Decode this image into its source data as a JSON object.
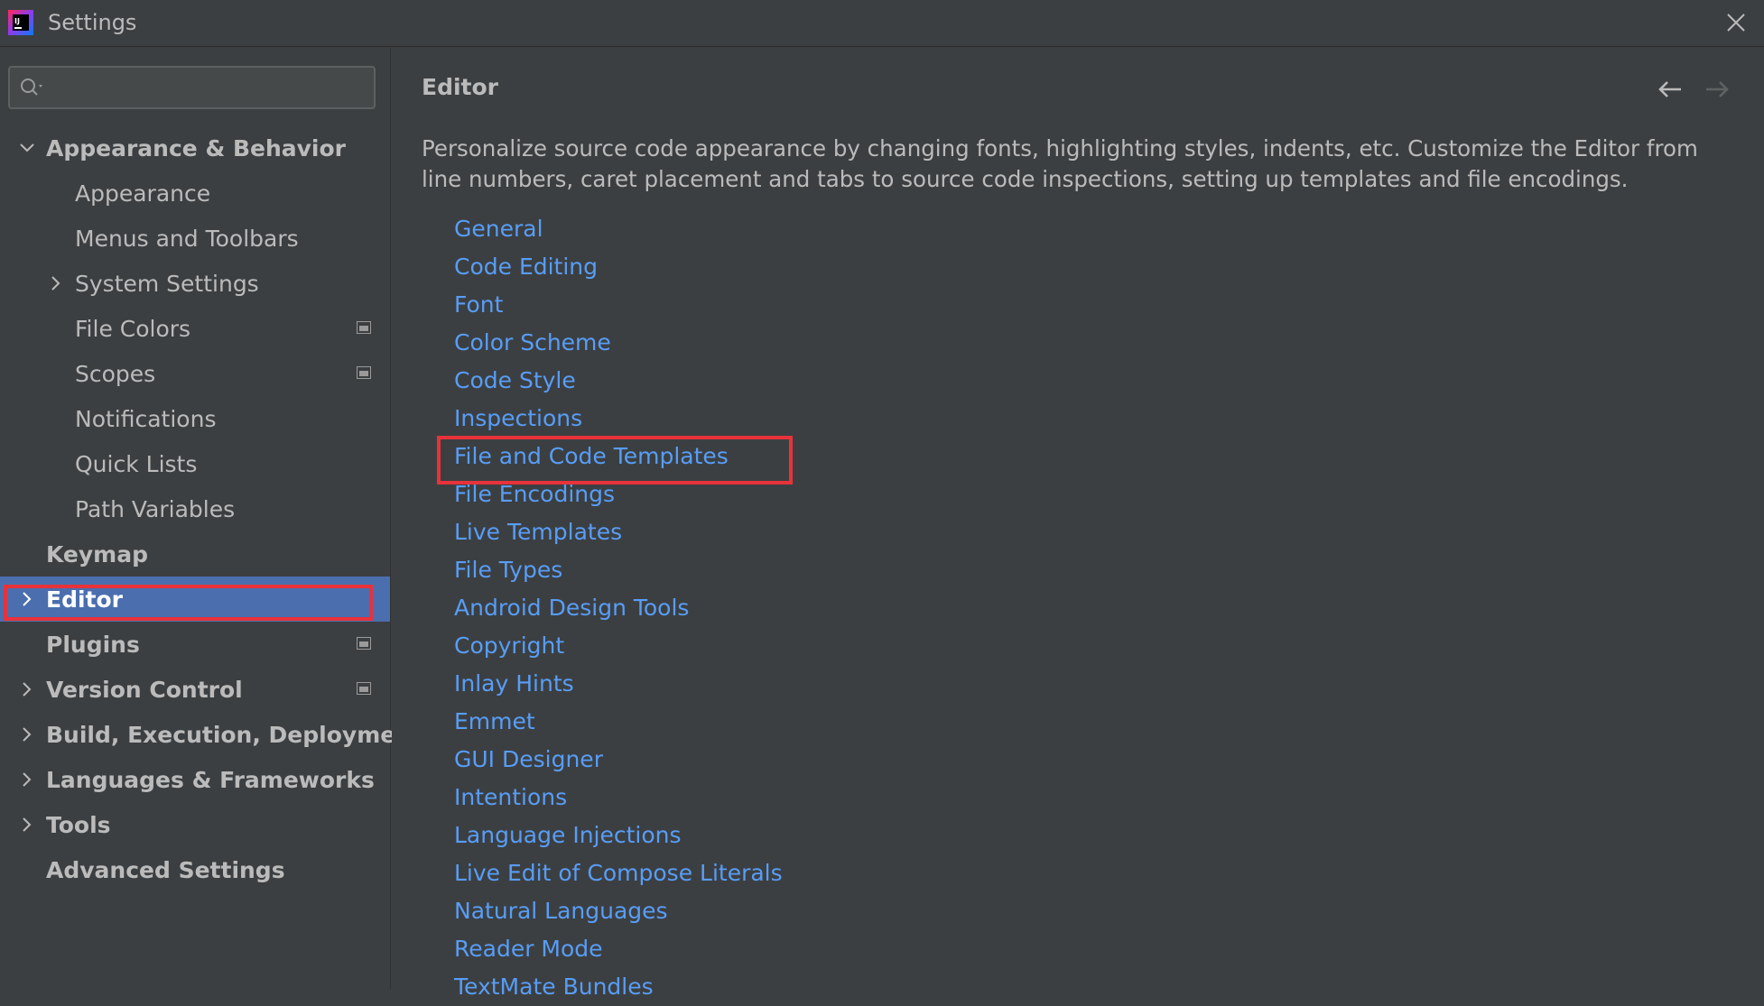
{
  "window": {
    "title": "Settings"
  },
  "search": {
    "placeholder": ""
  },
  "sidebar": {
    "items": [
      {
        "label": "Appearance & Behavior"
      },
      {
        "label": "Appearance"
      },
      {
        "label": "Menus and Toolbars"
      },
      {
        "label": "System Settings"
      },
      {
        "label": "File Colors"
      },
      {
        "label": "Scopes"
      },
      {
        "label": "Notifications"
      },
      {
        "label": "Quick Lists"
      },
      {
        "label": "Path Variables"
      },
      {
        "label": "Keymap"
      },
      {
        "label": "Editor"
      },
      {
        "label": "Plugins"
      },
      {
        "label": "Version Control"
      },
      {
        "label": "Build, Execution, Deployment"
      },
      {
        "label": "Languages & Frameworks"
      },
      {
        "label": "Tools"
      },
      {
        "label": "Advanced Settings"
      }
    ],
    "selected": "Editor"
  },
  "main": {
    "title": "Editor",
    "description": "Personalize source code appearance by changing fonts, highlighting styles, indents, etc. Customize the Editor from line numbers, caret placement and tabs to source code inspections, setting up templates and file encodings.",
    "links": [
      "General",
      "Code Editing",
      "Font",
      "Color Scheme",
      "Code Style",
      "Inspections",
      "File and Code Templates",
      "File Encodings",
      "Live Templates",
      "File Types",
      "Android Design Tools",
      "Copyright",
      "Inlay Hints",
      "Emmet",
      "GUI Designer",
      "Intentions",
      "Language Injections",
      "Live Edit of Compose Literals",
      "Natural Languages",
      "Reader Mode",
      "TextMate Bundles"
    ]
  },
  "colors": {
    "background": "#3c3f41",
    "selection": "#4b6eaf",
    "link": "#589df6",
    "highlight": "#e8323a"
  },
  "icons": {
    "logo": "intellij-logo-icon",
    "close": "close-icon",
    "search": "search-icon",
    "back": "arrow-left-icon",
    "forward": "arrow-right-icon",
    "project_level": "project-settings-icon"
  }
}
